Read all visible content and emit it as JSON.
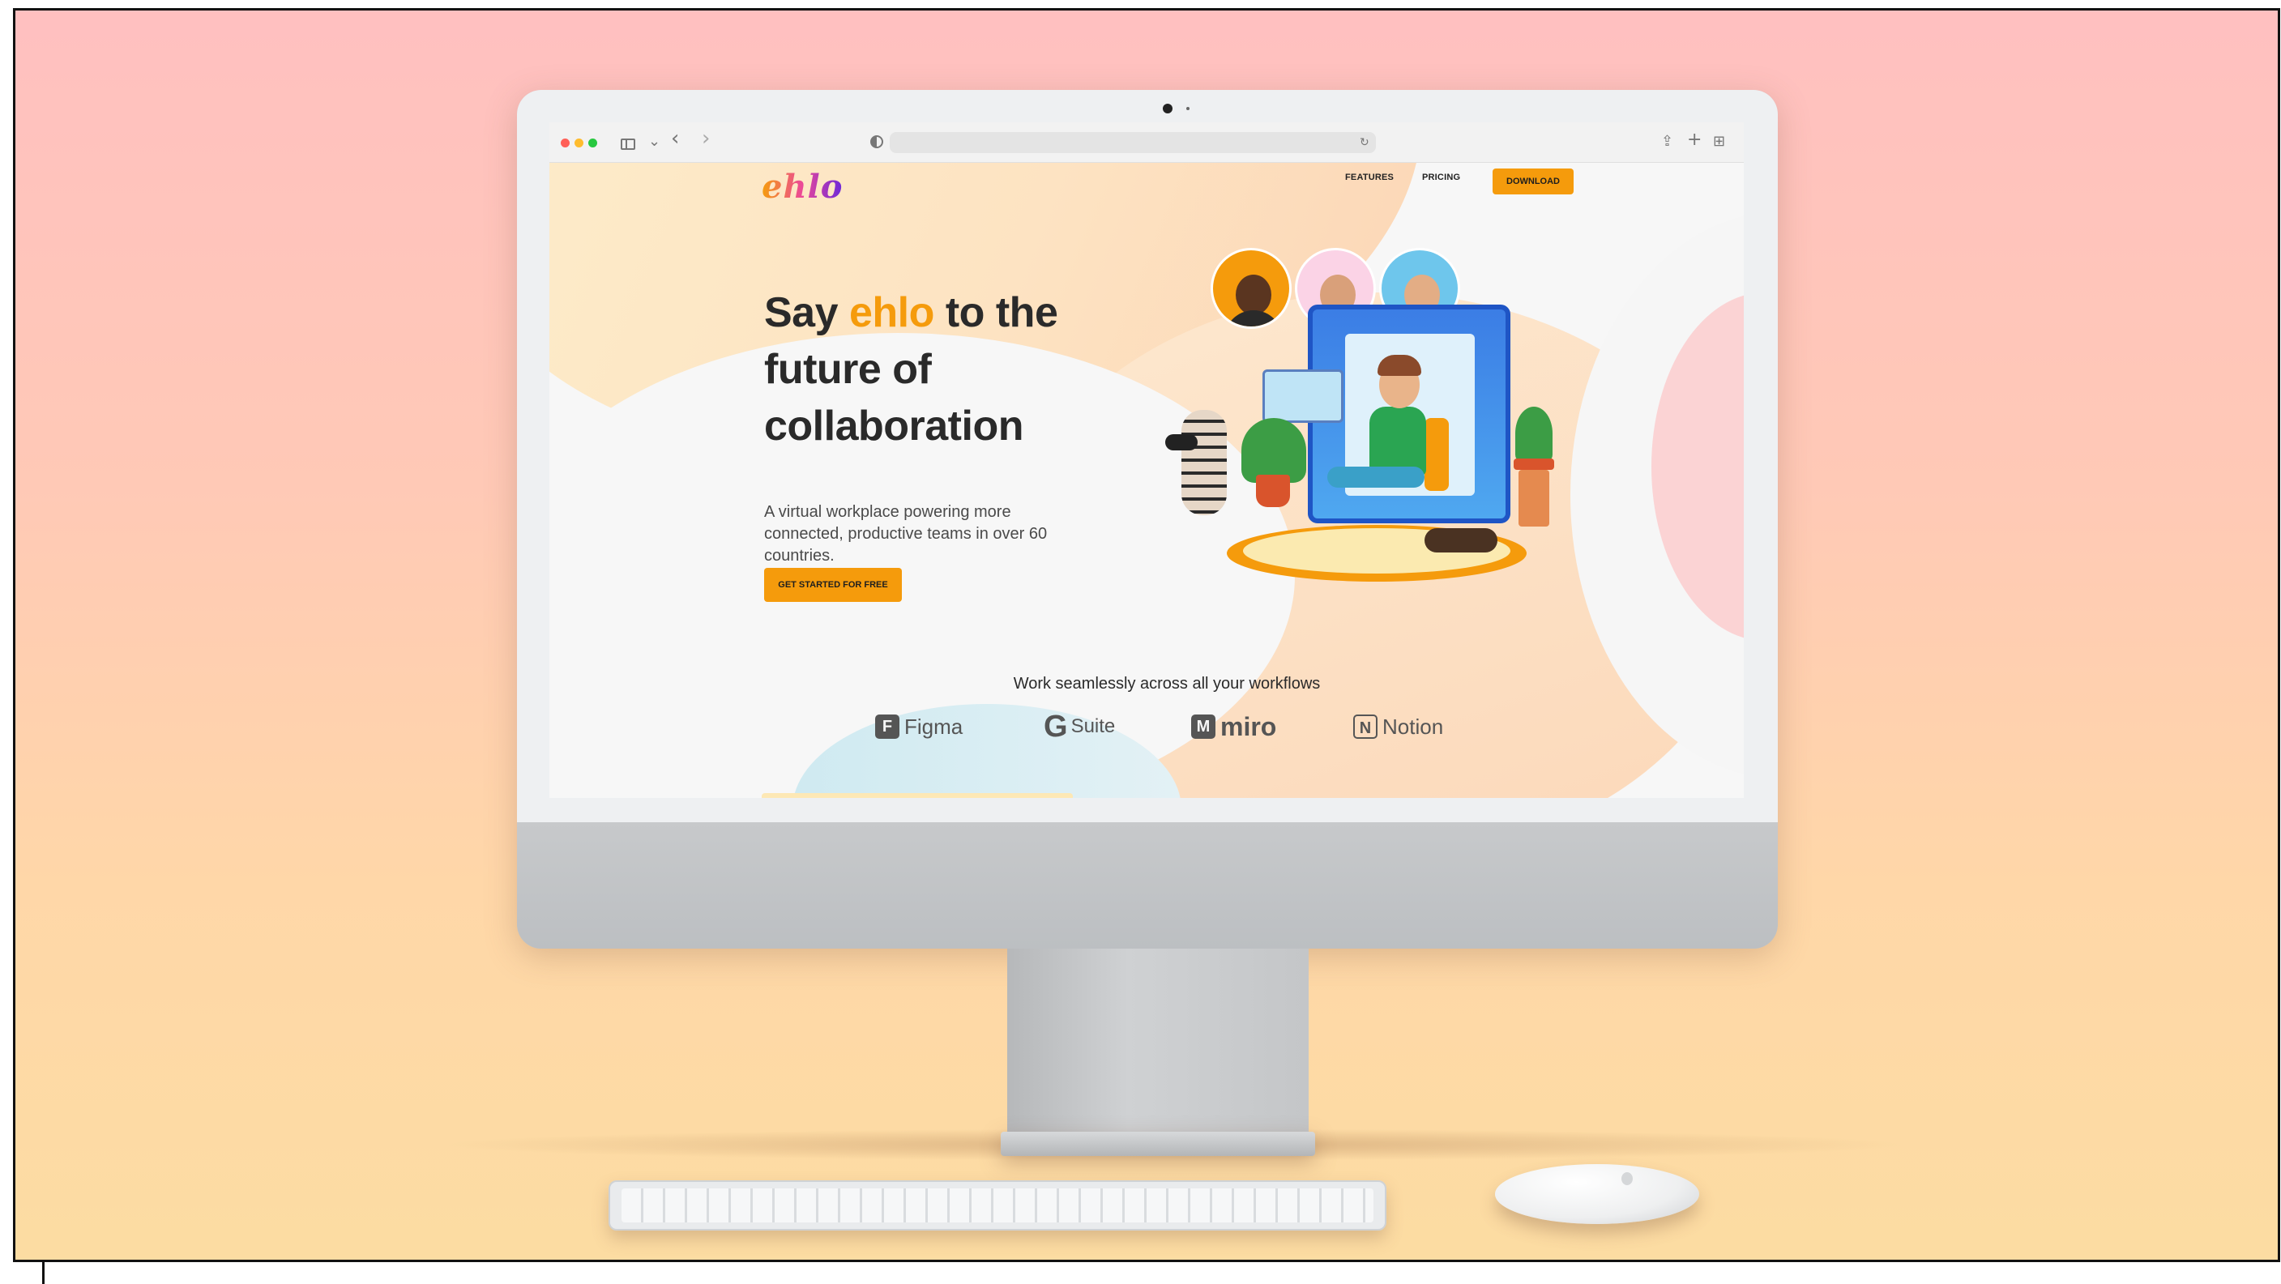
{
  "browser": {
    "toolbar_icons": [
      "sidebar-icon",
      "chevron-down-icon",
      "back-icon",
      "forward-icon",
      "shield-icon",
      "reload-icon",
      "share-icon",
      "new-tab-icon",
      "tab-overview-icon"
    ],
    "glyphs": {
      "back": "‹",
      "forward": "›",
      "chevron": "⌄",
      "reload": "↻",
      "share": "⇪",
      "new_tab": "+",
      "tabs": "⊞"
    },
    "address": ""
  },
  "site": {
    "logo": "ehlo",
    "nav": {
      "features": "FEATURES",
      "pricing": "PRICING",
      "download": "DOWNLOAD"
    },
    "hero": {
      "title_pre": "Say ",
      "title_accent": "ehlo",
      "title_post": " to the future of collaboration",
      "subtitle": "A virtual workplace powering more connected, productive teams in over 60 countries.",
      "cta": "GET STARTED FOR FREE"
    },
    "workflows": {
      "heading": "Work seamlessly across all your workflows",
      "brands": [
        {
          "glyph": "F",
          "name": "Figma"
        },
        {
          "glyph": "G",
          "name": "Suite"
        },
        {
          "glyph": "M",
          "name": "miro"
        },
        {
          "glyph": "N",
          "name": "Notion"
        }
      ]
    }
  },
  "colors": {
    "accent": "#f59b0c",
    "background_top": "#ffc0c0",
    "background_bottom": "#fcdca2"
  }
}
